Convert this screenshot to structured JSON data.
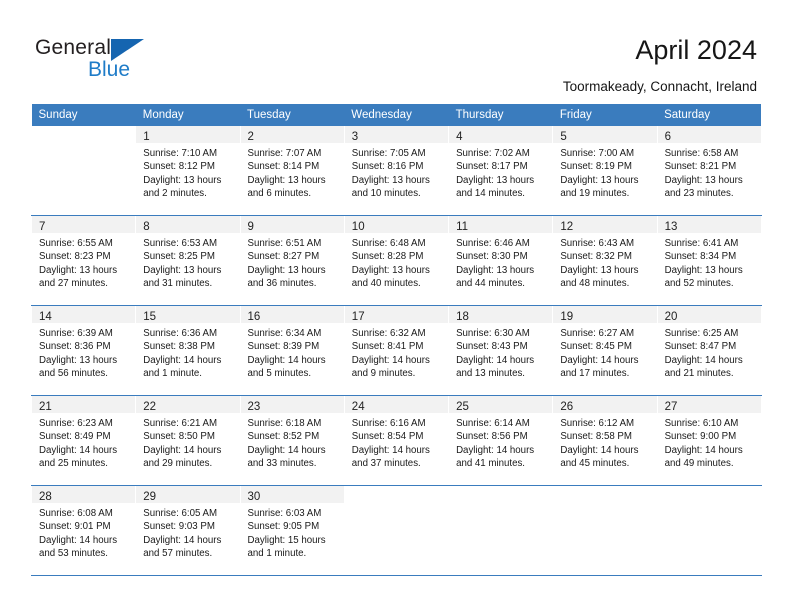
{
  "brand": {
    "word1": "General",
    "word2": "Blue",
    "triangle_color": "#1565b0",
    "blue_text_color": "#1f7cc8"
  },
  "header": {
    "title": "April 2024",
    "location": "Toormakeady, Connacht, Ireland"
  },
  "theme": {
    "header_blue": "#3a7cbe",
    "daynum_band": "#f2f2f2",
    "text": "#1a1a1a"
  },
  "weekday_headers": [
    "Sunday",
    "Monday",
    "Tuesday",
    "Wednesday",
    "Thursday",
    "Friday",
    "Saturday"
  ],
  "labels": {
    "sunrise_prefix": "Sunrise:",
    "sunset_prefix": "Sunset:",
    "daylight_prefix": "Daylight:"
  },
  "weeks": [
    [
      {
        "empty": true
      },
      {
        "day": "1",
        "sunrise": "Sunrise: 7:10 AM",
        "sunset": "Sunset: 8:12 PM",
        "daylight1": "Daylight: 13 hours",
        "daylight2": "and 2 minutes."
      },
      {
        "day": "2",
        "sunrise": "Sunrise: 7:07 AM",
        "sunset": "Sunset: 8:14 PM",
        "daylight1": "Daylight: 13 hours",
        "daylight2": "and 6 minutes."
      },
      {
        "day": "3",
        "sunrise": "Sunrise: 7:05 AM",
        "sunset": "Sunset: 8:16 PM",
        "daylight1": "Daylight: 13 hours",
        "daylight2": "and 10 minutes."
      },
      {
        "day": "4",
        "sunrise": "Sunrise: 7:02 AM",
        "sunset": "Sunset: 8:17 PM",
        "daylight1": "Daylight: 13 hours",
        "daylight2": "and 14 minutes."
      },
      {
        "day": "5",
        "sunrise": "Sunrise: 7:00 AM",
        "sunset": "Sunset: 8:19 PM",
        "daylight1": "Daylight: 13 hours",
        "daylight2": "and 19 minutes."
      },
      {
        "day": "6",
        "sunrise": "Sunrise: 6:58 AM",
        "sunset": "Sunset: 8:21 PM",
        "daylight1": "Daylight: 13 hours",
        "daylight2": "and 23 minutes."
      }
    ],
    [
      {
        "day": "7",
        "sunrise": "Sunrise: 6:55 AM",
        "sunset": "Sunset: 8:23 PM",
        "daylight1": "Daylight: 13 hours",
        "daylight2": "and 27 minutes."
      },
      {
        "day": "8",
        "sunrise": "Sunrise: 6:53 AM",
        "sunset": "Sunset: 8:25 PM",
        "daylight1": "Daylight: 13 hours",
        "daylight2": "and 31 minutes."
      },
      {
        "day": "9",
        "sunrise": "Sunrise: 6:51 AM",
        "sunset": "Sunset: 8:27 PM",
        "daylight1": "Daylight: 13 hours",
        "daylight2": "and 36 minutes."
      },
      {
        "day": "10",
        "sunrise": "Sunrise: 6:48 AM",
        "sunset": "Sunset: 8:28 PM",
        "daylight1": "Daylight: 13 hours",
        "daylight2": "and 40 minutes."
      },
      {
        "day": "11",
        "sunrise": "Sunrise: 6:46 AM",
        "sunset": "Sunset: 8:30 PM",
        "daylight1": "Daylight: 13 hours",
        "daylight2": "and 44 minutes."
      },
      {
        "day": "12",
        "sunrise": "Sunrise: 6:43 AM",
        "sunset": "Sunset: 8:32 PM",
        "daylight1": "Daylight: 13 hours",
        "daylight2": "and 48 minutes."
      },
      {
        "day": "13",
        "sunrise": "Sunrise: 6:41 AM",
        "sunset": "Sunset: 8:34 PM",
        "daylight1": "Daylight: 13 hours",
        "daylight2": "and 52 minutes."
      }
    ],
    [
      {
        "day": "14",
        "sunrise": "Sunrise: 6:39 AM",
        "sunset": "Sunset: 8:36 PM",
        "daylight1": "Daylight: 13 hours",
        "daylight2": "and 56 minutes."
      },
      {
        "day": "15",
        "sunrise": "Sunrise: 6:36 AM",
        "sunset": "Sunset: 8:38 PM",
        "daylight1": "Daylight: 14 hours",
        "daylight2": "and 1 minute."
      },
      {
        "day": "16",
        "sunrise": "Sunrise: 6:34 AM",
        "sunset": "Sunset: 8:39 PM",
        "daylight1": "Daylight: 14 hours",
        "daylight2": "and 5 minutes."
      },
      {
        "day": "17",
        "sunrise": "Sunrise: 6:32 AM",
        "sunset": "Sunset: 8:41 PM",
        "daylight1": "Daylight: 14 hours",
        "daylight2": "and 9 minutes."
      },
      {
        "day": "18",
        "sunrise": "Sunrise: 6:30 AM",
        "sunset": "Sunset: 8:43 PM",
        "daylight1": "Daylight: 14 hours",
        "daylight2": "and 13 minutes."
      },
      {
        "day": "19",
        "sunrise": "Sunrise: 6:27 AM",
        "sunset": "Sunset: 8:45 PM",
        "daylight1": "Daylight: 14 hours",
        "daylight2": "and 17 minutes."
      },
      {
        "day": "20",
        "sunrise": "Sunrise: 6:25 AM",
        "sunset": "Sunset: 8:47 PM",
        "daylight1": "Daylight: 14 hours",
        "daylight2": "and 21 minutes."
      }
    ],
    [
      {
        "day": "21",
        "sunrise": "Sunrise: 6:23 AM",
        "sunset": "Sunset: 8:49 PM",
        "daylight1": "Daylight: 14 hours",
        "daylight2": "and 25 minutes."
      },
      {
        "day": "22",
        "sunrise": "Sunrise: 6:21 AM",
        "sunset": "Sunset: 8:50 PM",
        "daylight1": "Daylight: 14 hours",
        "daylight2": "and 29 minutes."
      },
      {
        "day": "23",
        "sunrise": "Sunrise: 6:18 AM",
        "sunset": "Sunset: 8:52 PM",
        "daylight1": "Daylight: 14 hours",
        "daylight2": "and 33 minutes."
      },
      {
        "day": "24",
        "sunrise": "Sunrise: 6:16 AM",
        "sunset": "Sunset: 8:54 PM",
        "daylight1": "Daylight: 14 hours",
        "daylight2": "and 37 minutes."
      },
      {
        "day": "25",
        "sunrise": "Sunrise: 6:14 AM",
        "sunset": "Sunset: 8:56 PM",
        "daylight1": "Daylight: 14 hours",
        "daylight2": "and 41 minutes."
      },
      {
        "day": "26",
        "sunrise": "Sunrise: 6:12 AM",
        "sunset": "Sunset: 8:58 PM",
        "daylight1": "Daylight: 14 hours",
        "daylight2": "and 45 minutes."
      },
      {
        "day": "27",
        "sunrise": "Sunrise: 6:10 AM",
        "sunset": "Sunset: 9:00 PM",
        "daylight1": "Daylight: 14 hours",
        "daylight2": "and 49 minutes."
      }
    ],
    [
      {
        "day": "28",
        "sunrise": "Sunrise: 6:08 AM",
        "sunset": "Sunset: 9:01 PM",
        "daylight1": "Daylight: 14 hours",
        "daylight2": "and 53 minutes."
      },
      {
        "day": "29",
        "sunrise": "Sunrise: 6:05 AM",
        "sunset": "Sunset: 9:03 PM",
        "daylight1": "Daylight: 14 hours",
        "daylight2": "and 57 minutes."
      },
      {
        "day": "30",
        "sunrise": "Sunrise: 6:03 AM",
        "sunset": "Sunset: 9:05 PM",
        "daylight1": "Daylight: 15 hours",
        "daylight2": "and 1 minute."
      },
      {
        "empty": true
      },
      {
        "empty": true
      },
      {
        "empty": true
      },
      {
        "empty": true
      }
    ]
  ]
}
